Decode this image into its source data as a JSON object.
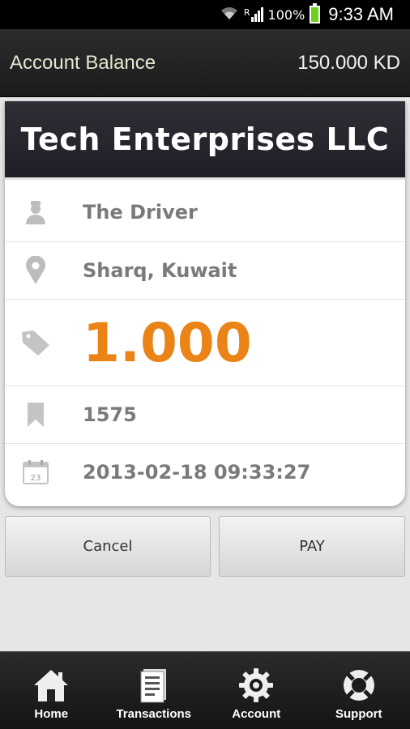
{
  "status_bar": {
    "signal_label": "R",
    "battery": "100%",
    "time": "9:33 AM"
  },
  "header": {
    "title": "Account Balance",
    "balance": "150.000 KD"
  },
  "card": {
    "merchant": "Tech Enterprises LLC",
    "driver": "The Driver",
    "location": "Sharq, Kuwait",
    "amount": "1.000",
    "reference": "1575",
    "datetime": "2013-02-18 09:33:27",
    "calendar_day": "23"
  },
  "actions": {
    "cancel": "Cancel",
    "pay": "PAY"
  },
  "tabs": [
    {
      "label": "Home",
      "icon": "home-icon"
    },
    {
      "label": "Transactions",
      "icon": "receipt-icon"
    },
    {
      "label": "Account",
      "icon": "gear-icon"
    },
    {
      "label": "Support",
      "icon": "lifebuoy-icon"
    }
  ],
  "colors": {
    "accent_amount": "#ea8416",
    "header_bg": "#1c1c1c",
    "battery": "#6fd11b"
  }
}
